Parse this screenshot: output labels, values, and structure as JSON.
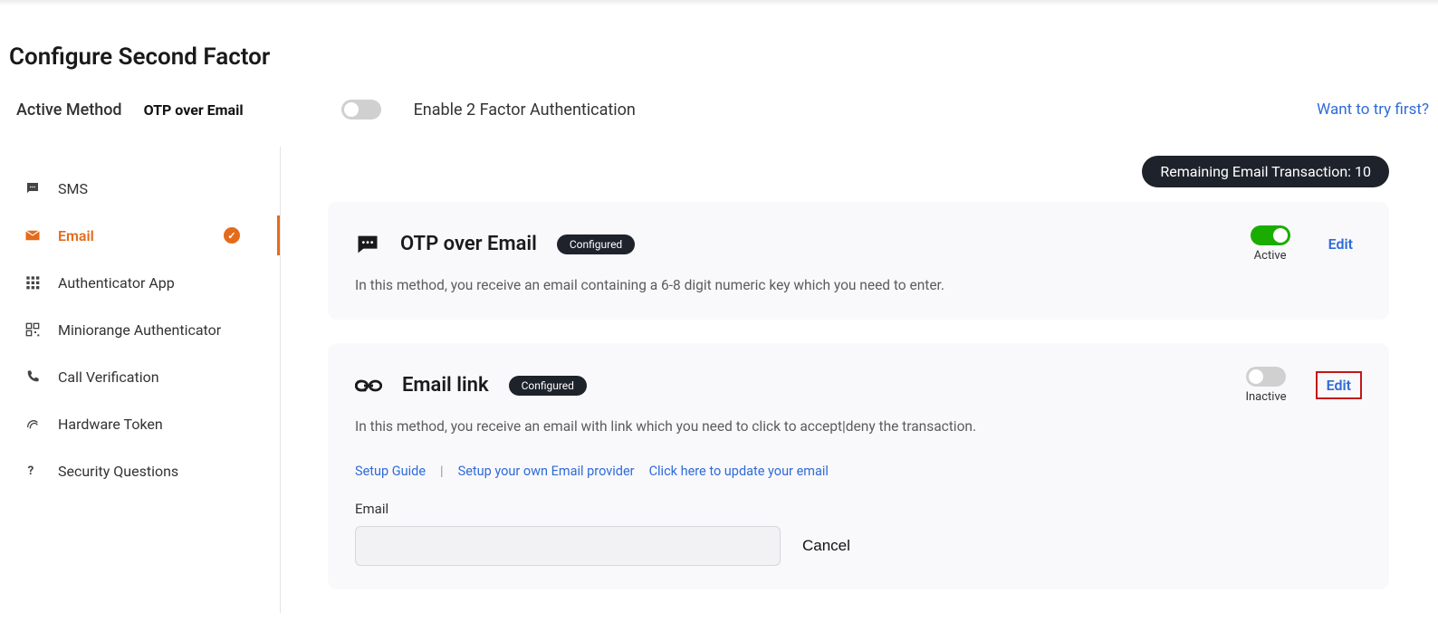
{
  "header": {
    "title": "Configure Second Factor",
    "activeMethodLabel": "Active Method",
    "activeMethodValue": "OTP over Email",
    "enableLabel": "Enable 2 Factor Authentication",
    "wantToTry": "Want to try first?"
  },
  "sidebar": {
    "items": [
      {
        "label": "SMS"
      },
      {
        "label": "Email"
      },
      {
        "label": "Authenticator App"
      },
      {
        "label": "Miniorange Authenticator"
      },
      {
        "label": "Call Verification"
      },
      {
        "label": "Hardware Token"
      },
      {
        "label": "Security Questions"
      }
    ]
  },
  "content": {
    "remainingBadge": "Remaining Email Transaction: 10",
    "cards": [
      {
        "title": "OTP over Email",
        "status": "Configured",
        "stateLabel": "Active",
        "edit": "Edit",
        "description": "In this method, you receive an email containing a 6-8 digit numeric key which you need to enter."
      },
      {
        "title": "Email link",
        "status": "Configured",
        "stateLabel": "Inactive",
        "edit": "Edit",
        "description": "In this method, you receive an email with link which you need to click to accept|deny the transaction.",
        "links": [
          "Setup Guide",
          "Setup your own Email provider",
          "Click here to update your email"
        ],
        "fieldLabel": "Email",
        "fieldValue": "",
        "cancel": "Cancel"
      }
    ]
  }
}
